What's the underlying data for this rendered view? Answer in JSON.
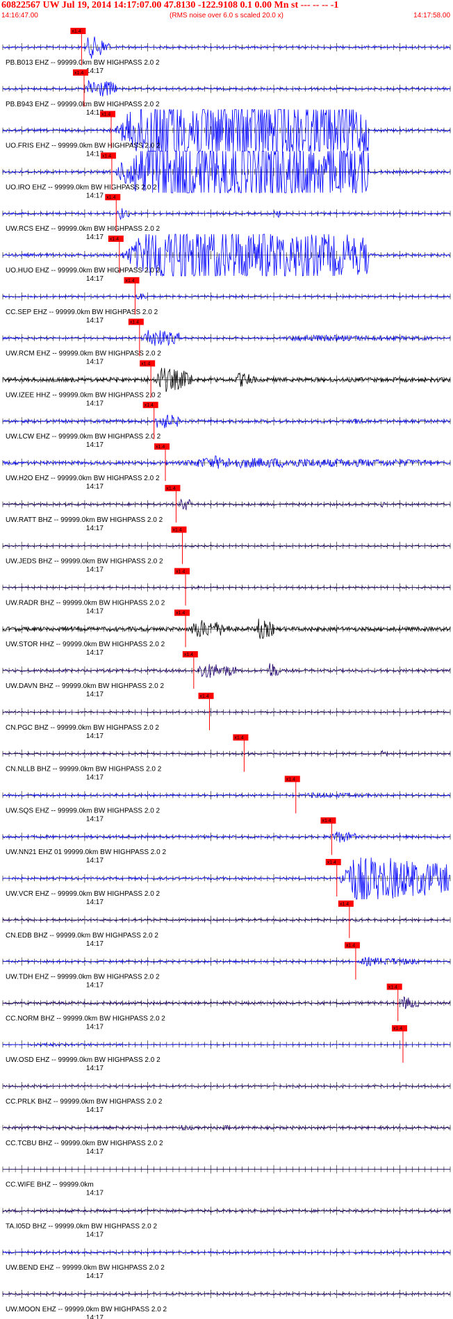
{
  "header": {
    "title": "60822567 UW Jul 19, 2014 14:17:07.00    47.8130 -122.9108  0.1 0.00 Mn st --- -- --   -1",
    "start_time": "14:16:47.00",
    "note": "(RMS noise over 6.0 s scaled 20.0 x)",
    "end_time": "14:17:58.00"
  },
  "chart_data": {
    "type": "line",
    "title": "60822567 UW Jul 19, 2014 14:17:07.00 47.8130 -122.9108 0.1 0.00 Mn st --- -- -- -1",
    "x_unit": "seconds after 14:16:47.00",
    "xlim": [
      0,
      71
    ],
    "tick_label": "14:17",
    "pick_label": "x1.4",
    "colors": {
      "blue": "#0000ff",
      "black": "#000000",
      "navy": "#200070",
      "pick": "#ff0000"
    },
    "traces": [
      {
        "label": "PB.B013 EHZ -- 99999.0km BW  HIGHPASS  2.0  2",
        "color": "blue",
        "pick": 12.5,
        "amp": 0.2,
        "burst": [
          13,
          17,
          2.2
        ],
        "extra": []
      },
      {
        "label": "PB.B943 EHZ -- 99999.0km BW  HIGHPASS  2.0  2",
        "color": "blue",
        "pick": 12.9,
        "amp": 0.22,
        "burst": [
          13,
          18,
          2.0
        ],
        "extra": []
      },
      {
        "label": "UO.FRIS EHZ -- 99999.0km BW  HIGHPASS  2.0  2",
        "color": "blue",
        "pick": 17.2,
        "amp": 0.25,
        "burst": [
          17.5,
          58,
          8.0
        ],
        "extra": []
      },
      {
        "label": "UO.IRO EHZ -- 99999.0km BW  HIGHPASS  2.0  2",
        "color": "blue",
        "pick": 17.3,
        "amp": 0.25,
        "burst": [
          17.5,
          58,
          8.0
        ],
        "extra": []
      },
      {
        "label": "UW.RCS EHZ -- 99999.0km BW  HIGHPASS  2.0  2",
        "color": "blue",
        "pick": 18.0,
        "amp": 0.2,
        "burst": [
          18,
          20,
          1.2
        ],
        "extra": [
          [
            43,
            44,
            1.0
          ]
        ]
      },
      {
        "label": "UO.HUO EHZ -- 99999.0km BW  HIGHPASS  2.0  2",
        "color": "blue",
        "pick": 18.5,
        "amp": 0.25,
        "burst": [
          18.5,
          58,
          6.0
        ],
        "extra": []
      },
      {
        "label": "CC.SEP EHZ -- 99999.0km BW  HIGHPASS  2.0  2",
        "color": "blue",
        "pick": 21.0,
        "amp": 0.18,
        "burst": [
          21,
          23,
          0.8
        ],
        "extra": []
      },
      {
        "label": "UW.RCM EHZ -- 99999.0km BW  HIGHPASS  2.0  2",
        "color": "blue",
        "pick": 21.7,
        "amp": 0.2,
        "burst": [
          22,
          28,
          1.8
        ],
        "extra": [
          [
            43,
            68,
            0.6
          ]
        ]
      },
      {
        "label": "UW.IZEE HHZ -- 99999.0km BW  HIGHPASS  2.0  2",
        "color": "black",
        "pick": 23.5,
        "amp": 0.4,
        "burst": [
          24,
          30,
          2.4
        ],
        "extra": [
          [
            37,
            40,
            1.4
          ]
        ]
      },
      {
        "label": "UW.LCW EHZ -- 99999.0km BW  HIGHPASS  2.0  2",
        "color": "blue",
        "pick": 24.0,
        "amp": 0.28,
        "burst": [
          24,
          28,
          1.6
        ],
        "extra": [
          [
            55,
            57,
            0.6
          ]
        ]
      },
      {
        "label": "UW.H2O EHZ -- 99999.0km BW  HIGHPASS  2.0  2",
        "color": "blue",
        "pick": 25.8,
        "amp": 0.3,
        "burst": [
          26,
          68,
          1.0
        ],
        "extra": [
          [
            33,
            37,
            1.3
          ]
        ]
      },
      {
        "label": "UW.RATT BHZ -- 99999.0km BW  HIGHPASS  2.0  2",
        "color": "navy",
        "pick": 27.5,
        "amp": 0.22,
        "burst": [
          28,
          30,
          1.3
        ],
        "extra": [
          [
            60,
            61,
            0.6
          ]
        ]
      },
      {
        "label": "UW.JEDS BHZ -- 99999.0km BW  HIGHPASS  2.0  2",
        "color": "navy",
        "pick": 28.5,
        "amp": 0.15,
        "burst": [
          29,
          31,
          0.3
        ],
        "extra": []
      },
      {
        "label": "UW.RADR BHZ -- 99999.0km BW  HIGHPASS  2.0  2",
        "color": "navy",
        "pick": 29.0,
        "amp": 0.15,
        "burst": [
          29.5,
          32,
          0.3
        ],
        "extra": []
      },
      {
        "label": "UW.STOR HHZ -- 99999.0km BW  HIGHPASS  2.0  2",
        "color": "black",
        "pick": 29.0,
        "amp": 0.4,
        "burst": [
          29.5,
          36,
          1.8
        ],
        "extra": [
          [
            40,
            43,
            2.0
          ]
        ]
      },
      {
        "label": "UW.DAVN BHZ -- 99999.0km BW  HIGHPASS  2.0  2",
        "color": "navy",
        "pick": 30.3,
        "amp": 0.25,
        "burst": [
          30.5,
          37,
          1.5
        ],
        "extra": [
          [
            42,
            44,
            1.6
          ]
        ]
      },
      {
        "label": "CN.PGC BHZ -- 99999.0km BW  HIGHPASS  2.0  2",
        "color": "navy",
        "pick": 32.8,
        "amp": 0.15,
        "burst": [
          33,
          35,
          0.2
        ],
        "extra": []
      },
      {
        "label": "CN.NLLB BHZ -- 99999.0km BW  HIGHPASS  2.0  2",
        "color": "navy",
        "pick": 38.3,
        "amp": 0.18,
        "burst": [
          38.5,
          40,
          0.3
        ],
        "extra": [
          [
            60,
            61,
            0.6
          ]
        ]
      },
      {
        "label": "UW.SQS EHZ -- 99999.0km BW  HIGHPASS  2.0  2",
        "color": "blue",
        "pick": 46.5,
        "amp": 0.2,
        "burst": [
          47,
          60,
          0.5
        ],
        "extra": []
      },
      {
        "label": "UW.NN21 EHZ 01 99999.0km BW  HIGHPASS  2.0  2",
        "color": "blue",
        "pick": 52.2,
        "amp": 0.25,
        "burst": [
          52,
          56,
          1.2
        ],
        "extra": []
      },
      {
        "label": "UW.VCR EHZ -- 99999.0km BW  HIGHPASS  2.0  2",
        "color": "blue",
        "pick": 53.0,
        "amp": 0.22,
        "burst": [
          53,
          71,
          4.5
        ],
        "extra": []
      },
      {
        "label": "CN.EDB BHZ -- 99999.0km BW  HIGHPASS  2.0  2",
        "color": "navy",
        "pick": 55.0,
        "amp": 0.2,
        "burst": [
          55,
          58,
          0.3
        ],
        "extra": []
      },
      {
        "label": "UW.TDH EHZ -- 99999.0km BW  HIGHPASS  2.0  2",
        "color": "blue",
        "pick": 56.0,
        "amp": 0.2,
        "burst": [
          56,
          66,
          0.8
        ],
        "extra": []
      },
      {
        "label": "CC.NORM BHZ -- 99999.0km BW  HIGHPASS  2.0  2",
        "color": "navy",
        "pick": 62.7,
        "amp": 0.25,
        "burst": [
          63,
          66,
          1.2
        ],
        "extra": []
      },
      {
        "label": "UW.OSD EHZ -- 99999.0km BW  HIGHPASS  2.0  2",
        "color": "blue",
        "pick": 63.5,
        "amp": 0.1,
        "burst": [
          3,
          20,
          0.3
        ],
        "extra": []
      },
      {
        "label": "CC.PRLK BHZ -- 99999.0km BW  HIGHPASS  2.0  2",
        "color": "navy",
        "pick": null,
        "amp": 0.2,
        "burst": null,
        "extra": []
      },
      {
        "label": "CC.TCBU BHZ -- 99999.0km BW  HIGHPASS  2.0  2",
        "color": "navy",
        "pick": null,
        "amp": 0.25,
        "burst": null,
        "extra": [
          [
            28,
            30,
            0.6
          ],
          [
            35,
            36,
            0.6
          ]
        ]
      },
      {
        "label": "CC.WIFE BHZ -- 99999.0km",
        "color": "navy",
        "pick": null,
        "amp": 0.0,
        "burst": null,
        "extra": []
      },
      {
        "label": "TA.I05D BHZ -- 99999.0km BW  HIGHPASS  2.0  2",
        "color": "navy",
        "pick": null,
        "amp": 0.25,
        "burst": null,
        "extra": []
      },
      {
        "label": "UW.BEND EHZ -- 99999.0km BW  HIGHPASS  2.0  2",
        "color": "blue",
        "pick": null,
        "amp": 0.2,
        "burst": null,
        "extra": []
      },
      {
        "label": "UW.MOON EHZ -- 99999.0km BW  HIGHPASS  2.0  2",
        "color": "navy",
        "pick": null,
        "amp": 0.2,
        "burst": null,
        "extra": []
      }
    ]
  }
}
